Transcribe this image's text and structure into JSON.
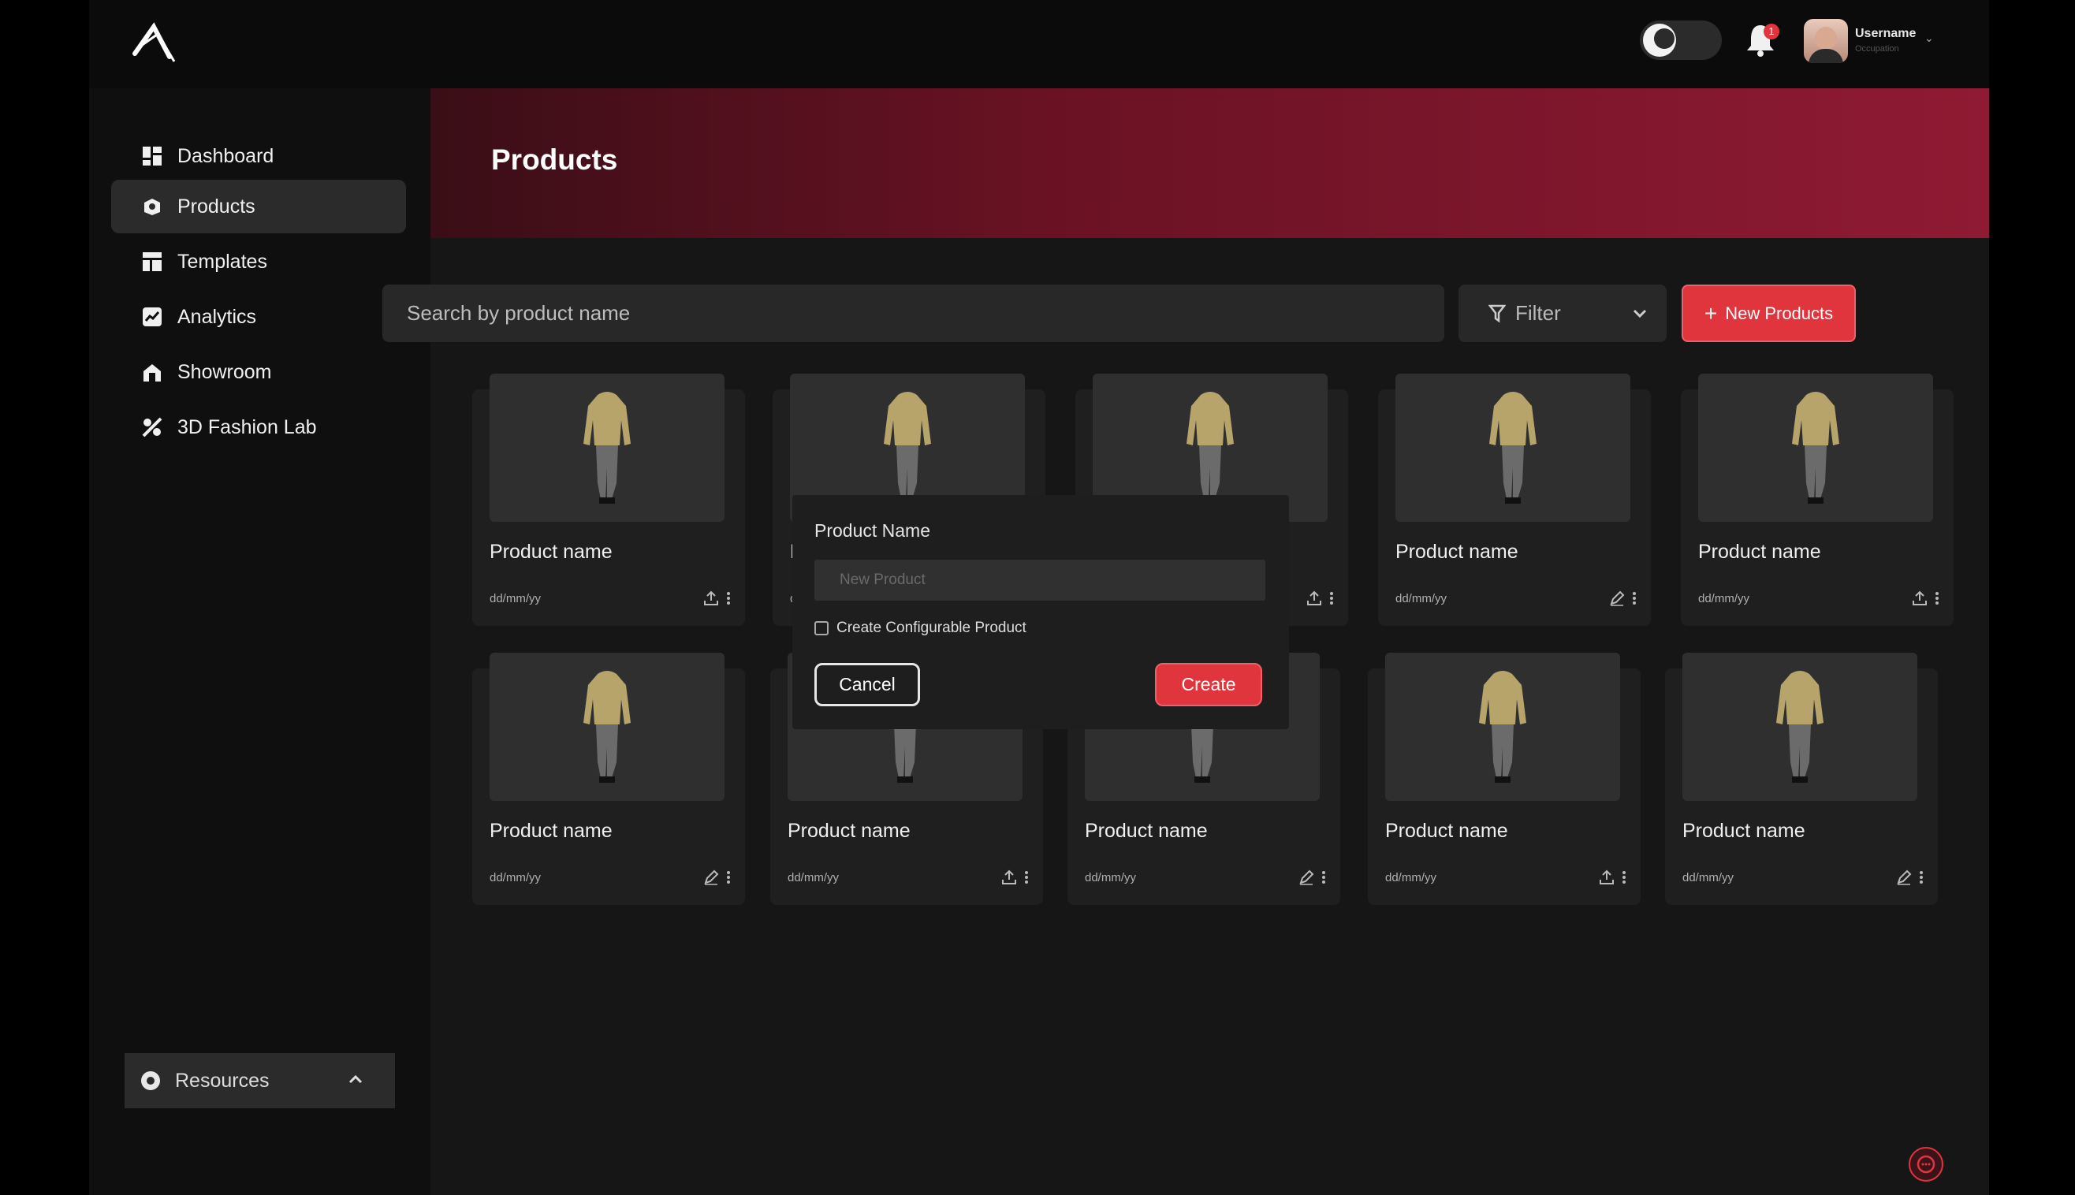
{
  "topbar": {
    "username": "Username",
    "occupation": "Occupation",
    "notification_count": "1"
  },
  "sidebar": {
    "items": [
      {
        "label": "Dashboard",
        "icon": "dashboard-icon"
      },
      {
        "label": "Products",
        "icon": "products-icon",
        "active": true
      },
      {
        "label": "Templates",
        "icon": "templates-icon"
      },
      {
        "label": "Analytics",
        "icon": "analytics-icon"
      },
      {
        "label": "Showroom",
        "icon": "showroom-icon"
      },
      {
        "label": "3D Fashion Lab",
        "icon": "fashion-lab-icon"
      }
    ],
    "resources_label": "Resources"
  },
  "header": {
    "title": "Products"
  },
  "toolbar": {
    "search_placeholder": "Search by product name",
    "filter_label": "Filter",
    "new_button_label": "New Products"
  },
  "products": [
    {
      "name": "Product name",
      "date": "dd/mm/yy",
      "action": "upload"
    },
    {
      "name": "Product name",
      "date": "dd/mm/yy",
      "action": "upload"
    },
    {
      "name": "Product name",
      "date": "dd/mm/yy",
      "action": "upload"
    },
    {
      "name": "Product name",
      "date": "dd/mm/yy",
      "action": "edit"
    },
    {
      "name": "Product name",
      "date": "dd/mm/yy",
      "action": "upload"
    },
    {
      "name": "Product name",
      "date": "dd/mm/yy",
      "action": "edit"
    },
    {
      "name": "Product name",
      "date": "dd/mm/yy",
      "action": "upload"
    },
    {
      "name": "Product name",
      "date": "dd/mm/yy",
      "action": "edit"
    },
    {
      "name": "Product name",
      "date": "dd/mm/yy",
      "action": "upload"
    },
    {
      "name": "Product name",
      "date": "dd/mm/yy",
      "action": "edit"
    }
  ],
  "dialog": {
    "label": "Product Name",
    "input_placeholder": "New Product",
    "checkbox_label": "Create Configurable Product",
    "cancel_label": "Cancel",
    "create_label": "Create"
  },
  "colors": {
    "accent": "#e1353d",
    "banner_start": "#3a0e16",
    "banner_end": "#8f1a33"
  }
}
